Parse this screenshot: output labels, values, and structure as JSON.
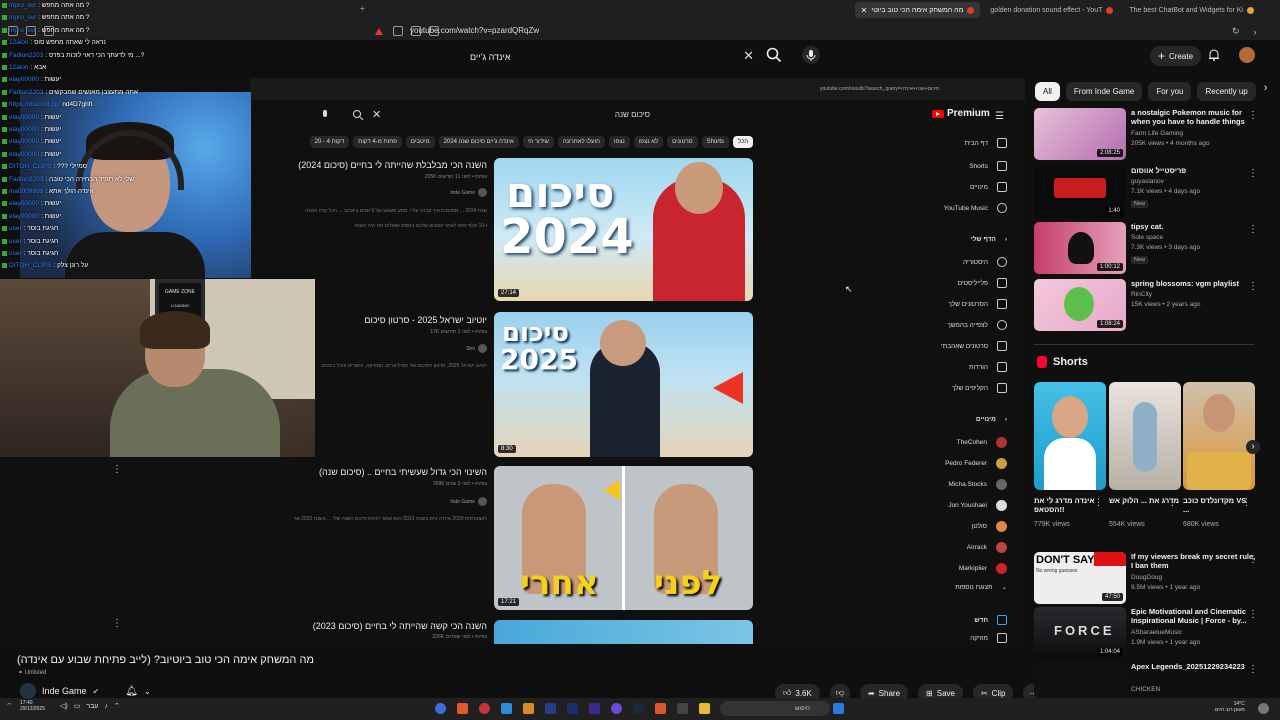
{
  "browser": {
    "tabs": [
      {
        "label": "מה המשחק אימה הכי טוב ביוטי"
      },
      {
        "label": "golden donation sound effect - YouT"
      },
      {
        "label": "The best ChatBot and Widgets for Ki"
      }
    ],
    "url": "youtube.com/watch?v=pzardQRqZw"
  },
  "header": {
    "search_value": "אינדה ג'יים",
    "create_label": "Create"
  },
  "inner": {
    "url": "youtube.com/results?search_query=סיכום+שנה+אינדה",
    "search_value": "סיכום שנה",
    "premium_label": "Premium",
    "chips": [
      "הכל",
      "Shorts",
      "סרטונים",
      "לא נצפו",
      "נצפו",
      "הועלו לאחרונה",
      "שידור חי",
      "אינדה ג'יים סיכום שנה 2024",
      "מיטבים",
      "פחות מ-4 דקות",
      "20 - 4 דקות"
    ],
    "videos": [
      {
        "title": "השנה הכי מבלבלת שהייתה לי בחיים (סיכום 2024)",
        "meta": "205K צפיות • לפני 11 חודשים",
        "channel": "Inde Game",
        "desc": "שנת 2024 ... מסכמים איך עברה עליי. מסע משוגע של 9 שנים ביוטיוב ... הכל קרה השנה",
        "desc2": "ו-10 אלף ימים לאחר השבוע שלכם באמת שואלים מה היה השנה",
        "duration": "27:14",
        "thumb_text": [
          "סיכום",
          "2024"
        ]
      },
      {
        "title": "יוטיוב ישראל 2025 - סרטון סיכום",
        "meta": "17K צפיות • לפני 1 חודשים",
        "channel": "Sho",
        "desc": "יוטיוב ישראל 2025, סרטון הסיכום של המיליונרים, המוזיקה, היוצרים והכל ביוטיוב",
        "duration": "8:30",
        "thumb_text": [
          "סיכום",
          "2025"
        ]
      },
      {
        "title": "השינוי הכי גדול שעשיתי בחיים .. (סיכום שנה)",
        "meta": "309K צפיות • לפני 3 שנים",
        "channel": "Inde Game",
        "desc": "להצטרפות 2020 אינדה גיים בשנת 2021! הוא אמור להיות סיכום השנה שלי ... בשנת 2022 אני",
        "duration": "17:21",
        "thumb_text": [
          "אחרי",
          "לפני"
        ]
      },
      {
        "title": "השנה הכי קשה שהייתה לי בחיים (סיכום 2023)",
        "meta": "226K צפיות • לפני שנתיים"
      }
    ],
    "sidebar": [
      {
        "label": "דף הבית",
        "icon": "home-icon"
      },
      {
        "label": "Shorts",
        "icon": "shorts-icon"
      },
      {
        "label": "מינויים",
        "icon": "subscriptions-icon"
      },
      {
        "label": "YouTube Music",
        "icon": "music-icon"
      }
    ],
    "you_header": "הדף שלי",
    "you_items": [
      {
        "label": "היסטוריה",
        "icon": "history-icon"
      },
      {
        "label": "פלייליסטים",
        "icon": "playlist-icon"
      },
      {
        "label": "הסרטונים שלך",
        "icon": "your-videos-icon"
      },
      {
        "label": "לצפייה בהמשך",
        "icon": "watch-later-icon"
      },
      {
        "label": "סרטונים שאהבתי",
        "icon": "like-icon"
      },
      {
        "label": "הורדות",
        "icon": "download-icon"
      },
      {
        "label": "הקליפים שלך",
        "icon": "clip-icon"
      }
    ],
    "subs_header": "מינויים",
    "subs": [
      "TheCohen",
      "Pedro Federer",
      "Micha.Stocks",
      "Jon Youshaei",
      "סולטן",
      "Airrack",
      "Markiplier",
      "תצוגת נוספות"
    ],
    "new_header": "חדש",
    "music_label": "מוזיקה"
  },
  "chat": [
    {
      "user": "mpro_svr",
      "msg": ": מה אתה מחפש ?"
    },
    {
      "user": "mpro_svr",
      "msg": ": מה אתה מחפש ?"
    },
    {
      "user": "mpro_svr",
      "msg": ": מה אתה מחפש ?"
    },
    {
      "user": "12alon",
      "msg": ": נראה לי שאתה מחפש סוס"
    },
    {
      "user": "Fadlon2203",
      "msg": ": מי לדעתך הכי ראוי לזכות בפרס ...?"
    },
    {
      "user": "12alon",
      "msg": ": אבא"
    },
    {
      "user": "elay00000",
      "msg": ": יעשות"
    },
    {
      "user": "Fadlon2203",
      "msg": ": אתה מתעצבן מאנשים שמבקשים"
    },
    {
      "user": "https://discord.gg/",
      "msg": "nd4D7ghft"
    },
    {
      "user": "elay00000",
      "msg": ": יעשות"
    },
    {
      "user": "elay00000",
      "msg": ": יעשות"
    },
    {
      "user": "elay00000",
      "msg": ": יעשות"
    },
    {
      "user": "elay00000",
      "msg": ": יעשות"
    },
    {
      "user": "DITOH_CLIPS",
      "msg": ": ??? סמיילי"
    },
    {
      "user": "Fadlon2203",
      "msg": ": שלי לא תמיד הבחירה הכי טובה"
    },
    {
      "user": "ma0009999",
      "msg": ": אינדה הולך אתא"
    },
    {
      "user": "elay00000",
      "msg": ": יעשות"
    },
    {
      "user": "elay00000",
      "msg": ": יעשות"
    },
    {
      "user": "user",
      "msg": ": חגיגת בוסר"
    },
    {
      "user": "user",
      "msg": ": חגיגת בוסר"
    },
    {
      "user": "user",
      "msg": ": חגיגת בוסר"
    },
    {
      "user": "DITOH_CLIPS",
      "msg": ": על רונן צלק"
    }
  ],
  "cam_labels": {
    "game_zone": "GAME ZONE",
    "loading": "LOADING"
  },
  "video": {
    "title": "מה המשחק אימה הכי טוב ביוטיוב? (לייב פתיחת שבוע עם אינדה)",
    "status": "Unlisted",
    "channel": "Inde Game",
    "likes": "3.6K",
    "share": "Share",
    "save": "Save",
    "clip": "Clip"
  },
  "right_chips": [
    "All",
    "From Inde Game",
    "For you",
    "Recently up"
  ],
  "recommendations": [
    {
      "title": "a nostalgic Pokemon music for when you have to handle things",
      "channel": "Farm Life Gaming",
      "meta": "205K views • 4 months ago",
      "duration": "2:08:25"
    },
    {
      "title": "פריסטייל אווסום",
      "channel": "guyaslanov",
      "meta": "7.1K views • 4 days ago",
      "badge": "New",
      "duration": "1:40"
    },
    {
      "title": "tipsy cat.",
      "channel": "Sole space",
      "meta": "7.3K views • 3 days ago",
      "badge": "New",
      "duration": "1:00:12"
    },
    {
      "title": "spring blossoms: vgm playlist",
      "channel": "RinCity",
      "meta": "15K views • 2 years ago",
      "duration": "1:08:24"
    }
  ],
  "shorts_label": "Shorts",
  "shorts": [
    {
      "title": "אינדה מדרג לי את הסטאפ!!",
      "views": "779K views"
    },
    {
      "title": "מדרג את ... הלוק אש",
      "views": "554K views"
    },
    {
      "title": "מקדונלדס כוכב VS ...",
      "views": "680K views"
    }
  ],
  "recommendations2": [
    {
      "title": "If my viewers break my secret rule, I ban them",
      "channel": "DougDoug",
      "meta": "9.5M views • 1 year ago",
      "duration": "47:50",
      "thumb_text": "DON'T SAY",
      "thumb_sub": "No wrong guesses"
    },
    {
      "title": "Epic Motivational and Cinematic Inspirational Music | Force - by...",
      "channel": "ASharaelueMusic",
      "meta": "1.9M views • 1 year ago",
      "duration": "1:04:04",
      "thumb_text": "FORCE"
    },
    {
      "title": "Apex Legends_20251229234223",
      "channel": "CHICKEN",
      "meta": ""
    }
  ],
  "taskbar": {
    "time": "17:40",
    "date": "29/12/2025",
    "search": "חיפוש",
    "lang": "עבר",
    "tray": "14°C",
    "tray_sub": "מעונן רוב היום"
  },
  "colors": {
    "bg": "#0f0f0f",
    "accent": "#ff0000",
    "link": "#3ea6ff"
  }
}
